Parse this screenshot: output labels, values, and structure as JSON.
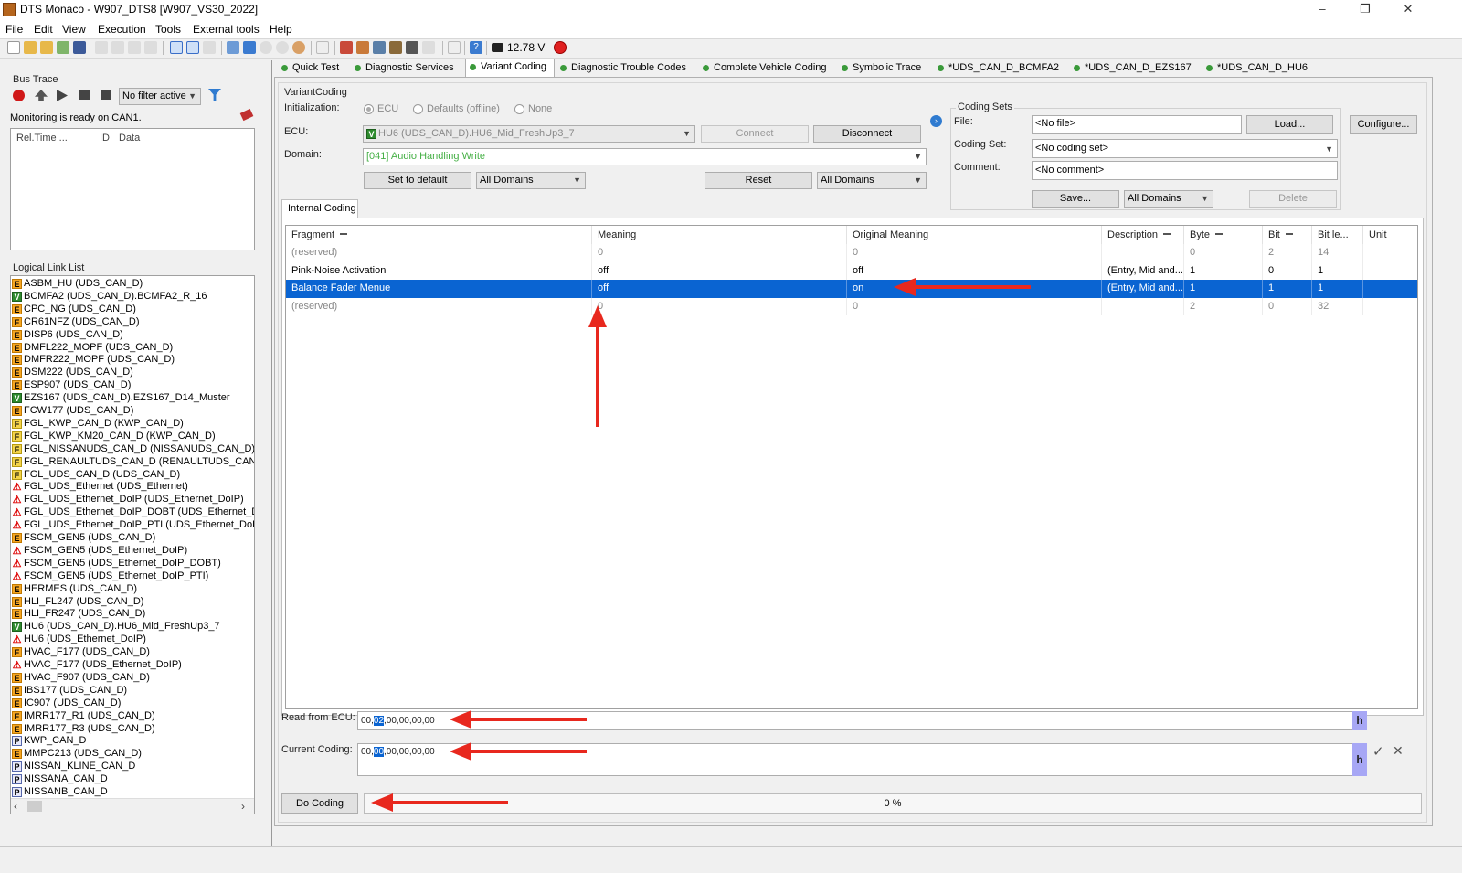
{
  "window": {
    "title": "DTS Monaco - W907_DTS8 [W907_VS30_2022]",
    "minimize": "–",
    "restore": "❐",
    "close": "✕"
  },
  "menu": [
    "File",
    "Edit",
    "View",
    "Execution",
    "Tools",
    "External tools",
    "Help"
  ],
  "toolbar": {
    "voltage": "12.78 V"
  },
  "bus_trace": {
    "title": "Bus Trace",
    "filter": "No filter active",
    "status": "Monitoring is ready on CAN1.",
    "columns": [
      "Rel.Time ...",
      "ID",
      "Data"
    ]
  },
  "logical_link_list": {
    "title": "Logical Link List",
    "items": [
      {
        "badge": "E",
        "label": "ASBM_HU (UDS_CAN_D)"
      },
      {
        "badge": "V",
        "label": "BCMFA2 (UDS_CAN_D).BCMFA2_R_16"
      },
      {
        "badge": "E",
        "label": "CPC_NG (UDS_CAN_D)"
      },
      {
        "badge": "E",
        "label": "CR61NFZ (UDS_CAN_D)"
      },
      {
        "badge": "E",
        "label": "DISP6 (UDS_CAN_D)"
      },
      {
        "badge": "E",
        "label": "DMFL222_MOPF (UDS_CAN_D)"
      },
      {
        "badge": "E",
        "label": "DMFR222_MOPF (UDS_CAN_D)"
      },
      {
        "badge": "E",
        "label": "DSM222 (UDS_CAN_D)"
      },
      {
        "badge": "E",
        "label": "ESP907 (UDS_CAN_D)"
      },
      {
        "badge": "V",
        "label": "EZS167 (UDS_CAN_D).EZS167_D14_Muster"
      },
      {
        "badge": "E",
        "label": "FCW177 (UDS_CAN_D)"
      },
      {
        "badge": "F",
        "label": "FGL_KWP_CAN_D (KWP_CAN_D)"
      },
      {
        "badge": "F",
        "label": "FGL_KWP_KM20_CAN_D (KWP_CAN_D)"
      },
      {
        "badge": "F",
        "label": "FGL_NISSANUDS_CAN_D (NISSANUDS_CAN_D)"
      },
      {
        "badge": "F",
        "label": "FGL_RENAULTUDS_CAN_D (RENAULTUDS_CAN_D)"
      },
      {
        "badge": "F",
        "label": "FGL_UDS_CAN_D (UDS_CAN_D)"
      },
      {
        "badge": "W",
        "label": "FGL_UDS_Ethernet (UDS_Ethernet)"
      },
      {
        "badge": "W",
        "label": "FGL_UDS_Ethernet_DoIP (UDS_Ethernet_DoIP)"
      },
      {
        "badge": "W",
        "label": "FGL_UDS_Ethernet_DoIP_DOBT (UDS_Ethernet_DoIP_DOBT)"
      },
      {
        "badge": "W",
        "label": "FGL_UDS_Ethernet_DoIP_PTI (UDS_Ethernet_DoIP_PTI)"
      },
      {
        "badge": "E",
        "label": "FSCM_GEN5 (UDS_CAN_D)"
      },
      {
        "badge": "W",
        "label": "FSCM_GEN5 (UDS_Ethernet_DoIP)"
      },
      {
        "badge": "W",
        "label": "FSCM_GEN5 (UDS_Ethernet_DoIP_DOBT)"
      },
      {
        "badge": "W",
        "label": "FSCM_GEN5 (UDS_Ethernet_DoIP_PTI)"
      },
      {
        "badge": "E",
        "label": "HERMES (UDS_CAN_D)"
      },
      {
        "badge": "E",
        "label": "HLI_FL247 (UDS_CAN_D)"
      },
      {
        "badge": "E",
        "label": "HLI_FR247 (UDS_CAN_D)"
      },
      {
        "badge": "V",
        "label": "HU6 (UDS_CAN_D).HU6_Mid_FreshUp3_7"
      },
      {
        "badge": "W",
        "label": "HU6 (UDS_Ethernet_DoIP)"
      },
      {
        "badge": "E",
        "label": "HVAC_F177 (UDS_CAN_D)"
      },
      {
        "badge": "W",
        "label": "HVAC_F177 (UDS_Ethernet_DoIP)"
      },
      {
        "badge": "E",
        "label": "HVAC_F907 (UDS_CAN_D)"
      },
      {
        "badge": "E",
        "label": "IBS177 (UDS_CAN_D)"
      },
      {
        "badge": "E",
        "label": "IC907 (UDS_CAN_D)"
      },
      {
        "badge": "E",
        "label": "IMRR177_R1 (UDS_CAN_D)"
      },
      {
        "badge": "E",
        "label": "IMRR177_R3 (UDS_CAN_D)"
      },
      {
        "badge": "P",
        "label": "KWP_CAN_D"
      },
      {
        "badge": "E",
        "label": "MMPC213 (UDS_CAN_D)"
      },
      {
        "badge": "P",
        "label": "NISSAN_KLINE_CAN_D"
      },
      {
        "badge": "P",
        "label": "NISSANA_CAN_D"
      },
      {
        "badge": "P",
        "label": "NISSANB_CAN_D"
      }
    ]
  },
  "tabs": [
    {
      "label": "Quick Test"
    },
    {
      "label": "Diagnostic Services"
    },
    {
      "label": "Variant Coding",
      "active": true
    },
    {
      "label": "Diagnostic Trouble Codes"
    },
    {
      "label": "Complete Vehicle Coding"
    },
    {
      "label": "Symbolic Trace"
    },
    {
      "label": "*UDS_CAN_D_BCMFA2"
    },
    {
      "label": "*UDS_CAN_D_EZS167"
    },
    {
      "label": "*UDS_CAN_D_HU6"
    }
  ],
  "variant_coding": {
    "group_title": "VariantCoding",
    "init_label": "Initialization:",
    "init_options": [
      "ECU",
      "Defaults (offline)",
      "None"
    ],
    "ecu_label": "ECU:",
    "ecu_value": "HU6 (UDS_CAN_D).HU6_Mid_FreshUp3_7",
    "connect": "Connect",
    "disconnect": "Disconnect",
    "domain_label": "Domain:",
    "domain_value": "[041] Audio Handling Write",
    "set_default": "Set to default",
    "all_domains_1": "All Domains",
    "reset": "Reset",
    "all_domains_2": "All Domains"
  },
  "coding_sets": {
    "title": "Coding Sets",
    "file_label": "File:",
    "file_value": "<No file>",
    "load": "Load...",
    "configure": "Configure...",
    "set_label": "Coding Set:",
    "set_value": "<No coding set>",
    "comment_label": "Comment:",
    "comment_value": "<No comment>",
    "save": "Save...",
    "all_domains": "All Domains",
    "delete": "Delete"
  },
  "internal_coding_tab": "Internal Coding",
  "grid": {
    "columns": [
      "Fragment",
      "Meaning",
      "Original Meaning",
      "Description",
      "Byte",
      "Bit",
      "Bit le...",
      "Unit"
    ],
    "rows": [
      {
        "cells": [
          "(reserved)",
          "0",
          "0",
          "",
          "0",
          "2",
          "14",
          ""
        ],
        "style": "gray"
      },
      {
        "cells": [
          "Pink-Noise Activation",
          "off",
          "off",
          "(Entry, Mid and...",
          "1",
          "0",
          "1",
          ""
        ],
        "style": "normal"
      },
      {
        "cells": [
          "Balance Fader Menue",
          "off",
          "on",
          "(Entry, Mid and...",
          "1",
          "1",
          "1",
          ""
        ],
        "style": "selected"
      },
      {
        "cells": [
          "(reserved)",
          "0",
          "0",
          "",
          "2",
          "0",
          "32",
          ""
        ],
        "style": "gray"
      }
    ]
  },
  "read_from_ecu": {
    "label": "Read from ECU:",
    "pre": "00,",
    "sel": "02",
    "post": ",00,00,00,00",
    "h": "h"
  },
  "current_coding": {
    "label": "Current Coding:",
    "pre": "00,",
    "sel": "00",
    "post": ",00,00,00,00",
    "h": "h",
    "apply": "✓",
    "cancel": "✕"
  },
  "do_coding": {
    "label": "Do Coding",
    "progress": "0 %"
  },
  "colors": {
    "accent": "#0a64d2",
    "arrow": "#e8281e",
    "tab_dot": "#3a9a3a"
  }
}
